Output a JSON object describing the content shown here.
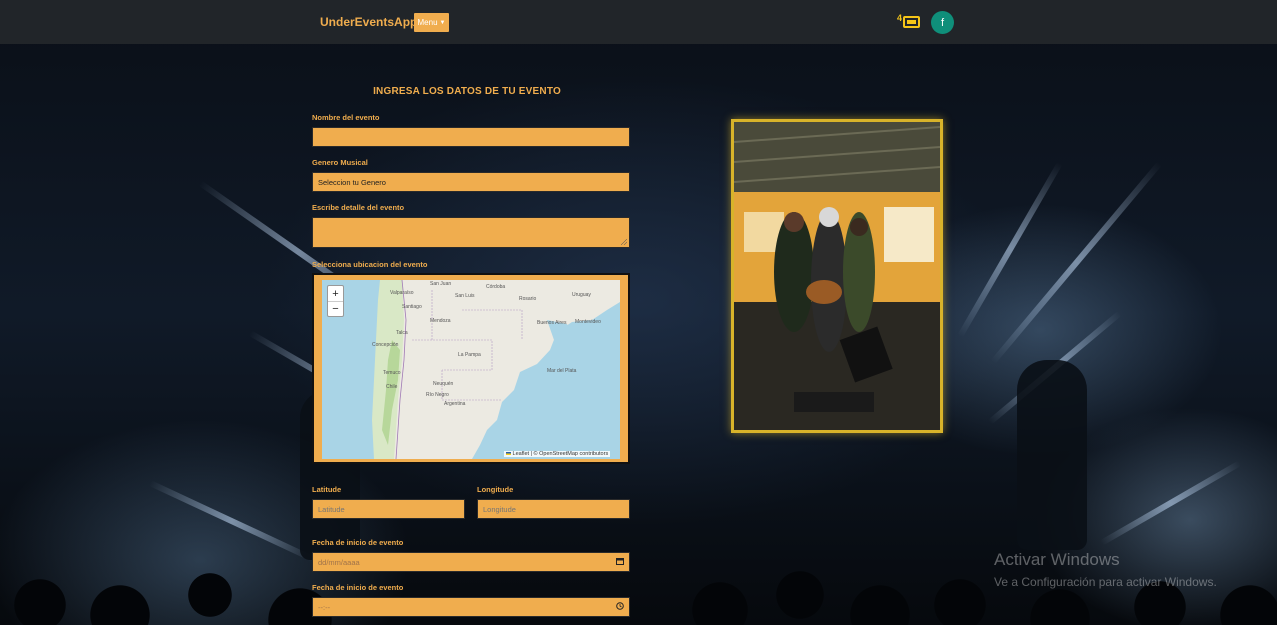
{
  "navbar": {
    "brand": "UnderEventsApp",
    "menu_label": "Menu",
    "ticket_count": "4",
    "avatar_letter": "f"
  },
  "form": {
    "title": "INGRESA LOS DATOS DE TU EVENTO",
    "name_label": "Nombre del evento",
    "genre_label": "Genero Musical",
    "genre_value": "Seleccion tu Genero",
    "detail_label": "Escribe detalle del evento",
    "location_label": "Selecciona ubicacion del evento",
    "latitude_label": "Latitude",
    "latitude_placeholder": "Latitude",
    "longitude_label": "Longitude",
    "longitude_placeholder": "Longitude",
    "start_date_label": "Fecha de inicio de evento",
    "start_date_placeholder": "dd/mm/aaaa",
    "start_time_label": "Fecha de inicio de evento",
    "start_time_placeholder": "--:--"
  },
  "map": {
    "zoom_in": "+",
    "zoom_out": "−",
    "attribution": "Leaflet | © OpenStreetMap contributors",
    "labels": {
      "san_juan": "San Juan",
      "valparaiso": "Valparaíso",
      "santiago": "Santiago",
      "san_luis": "San Luis",
      "cordoba": "Córdoba",
      "rosario": "Rosario",
      "uruguay": "Uruguay",
      "buenos_aires": "Buenos Aires",
      "montevideo": "Montevideo",
      "talca": "Talca",
      "mendoza": "Mendoza",
      "concepcion": "Concepción",
      "la_pampa": "La Pampa",
      "temuco": "Temuco",
      "mar_del_plata": "Mar del Plata",
      "chile": "Chile",
      "neuquen": "Neuquén",
      "rio_negro": "Río Negro",
      "argentina": "Argentina"
    }
  },
  "watermark": {
    "line1": "Activar Windows",
    "line2": "Ve a Configuración para activar Windows."
  },
  "colors": {
    "accent": "#f0ad4e",
    "navbar": "#212529",
    "avatar": "#0f8f7a",
    "photo_border": "#d8b32a"
  }
}
